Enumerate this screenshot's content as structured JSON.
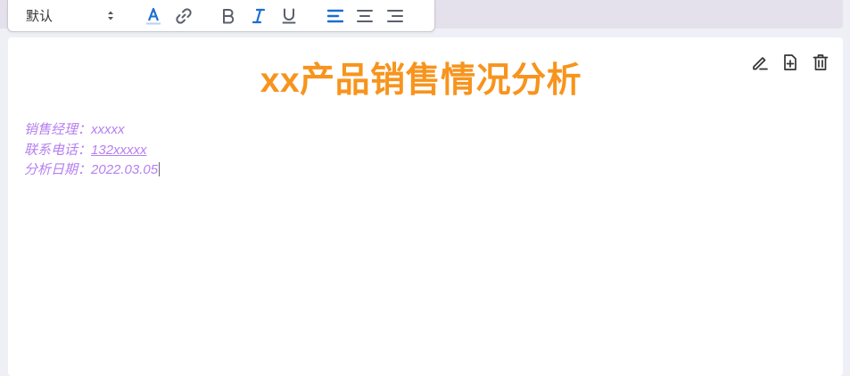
{
  "toolbar": {
    "font_select": {
      "value": "默认"
    },
    "buttons": [
      {
        "name": "text-color",
        "icon": "text-color-icon"
      },
      {
        "name": "link",
        "icon": "link-icon"
      },
      {
        "name": "bold",
        "icon": "bold-icon"
      },
      {
        "name": "italic",
        "icon": "italic-icon"
      },
      {
        "name": "underline",
        "icon": "underline-icon"
      },
      {
        "name": "align-left",
        "icon": "align-left-icon"
      },
      {
        "name": "align-center",
        "icon": "align-center-icon"
      },
      {
        "name": "align-right",
        "icon": "align-right-icon"
      }
    ]
  },
  "document": {
    "title": "xx产品销售情况分析",
    "fields": [
      {
        "label": "销售经理：",
        "value": "xxxxx"
      },
      {
        "label": "联系电话：",
        "value": "132xxxxx"
      },
      {
        "label": "分析日期：",
        "value": "2022.03.05"
      }
    ]
  },
  "card_actions": [
    "edit-icon",
    "add-page-icon",
    "trash-icon"
  ],
  "colors": {
    "title": "#f7941d",
    "meta_text": "#b67ff0",
    "accent_blue": "#1a6fd1",
    "icon_gray": "#5a5f6b"
  }
}
